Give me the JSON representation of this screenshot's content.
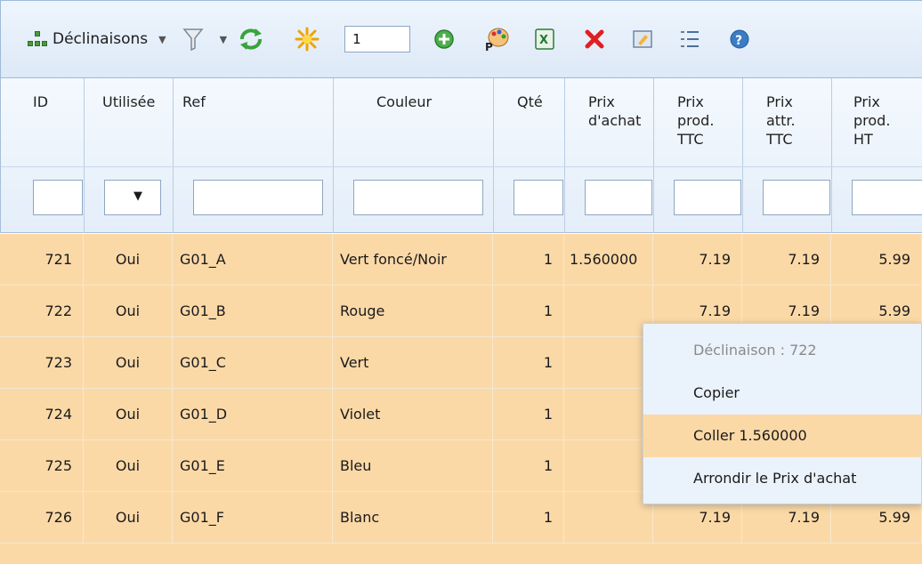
{
  "toolbar": {
    "view_label": "Déclinaisons",
    "quantity_value": "1",
    "colors": {
      "bar_top": "#eef5fd",
      "bar_bottom": "#dde9f7"
    }
  },
  "columns": [
    {
      "label": "ID"
    },
    {
      "label": "Utilisée"
    },
    {
      "label": "Ref"
    },
    {
      "label": "Couleur"
    },
    {
      "label": "Qté"
    },
    {
      "label": "Prix\nd'achat"
    },
    {
      "label": "Prix\nprod.\nTTC"
    },
    {
      "label": "Prix\nattr.\nTTC"
    },
    {
      "label": "Prix\nprod.\nHT"
    }
  ],
  "filters": {
    "used_select_symbol": "▼"
  },
  "rows": [
    {
      "id": "721",
      "used": "Oui",
      "ref": "G01_A",
      "color": "Vert foncé/Noir",
      "qty": "1",
      "purchase": "1.560000",
      "ttc": "7.19",
      "attr_ttc": "7.19",
      "ht": "5.99"
    },
    {
      "id": "722",
      "used": "Oui",
      "ref": "G01_B",
      "color": "Rouge",
      "qty": "1",
      "purchase": "",
      "ttc": "7.19",
      "attr_ttc": "7.19",
      "ht": "5.99"
    },
    {
      "id": "723",
      "used": "Oui",
      "ref": "G01_C",
      "color": "Vert",
      "qty": "1",
      "purchase": "",
      "ttc": "",
      "attr_ttc": "",
      "ht": ""
    },
    {
      "id": "724",
      "used": "Oui",
      "ref": "G01_D",
      "color": "Violet",
      "qty": "1",
      "purchase": "",
      "ttc": "",
      "attr_ttc": "",
      "ht": ""
    },
    {
      "id": "725",
      "used": "Oui",
      "ref": "G01_E",
      "color": "Bleu",
      "qty": "1",
      "purchase": "",
      "ttc": "",
      "attr_ttc": "",
      "ht": ""
    },
    {
      "id": "726",
      "used": "Oui",
      "ref": "G01_F",
      "color": "Blanc",
      "qty": "1",
      "purchase": "",
      "ttc": "7.19",
      "attr_ttc": "7.19",
      "ht": "5.99"
    }
  ],
  "context_menu": {
    "title": "Déclinaison : 722",
    "copy": "Copier",
    "paste": "Coller 1.560000",
    "round": "Arrondir le Prix d'achat"
  },
  "colors": {
    "row_bg": "#fbd9a7",
    "menu_bg": "#eaf2fc",
    "header_border": "#a7bfd9"
  }
}
